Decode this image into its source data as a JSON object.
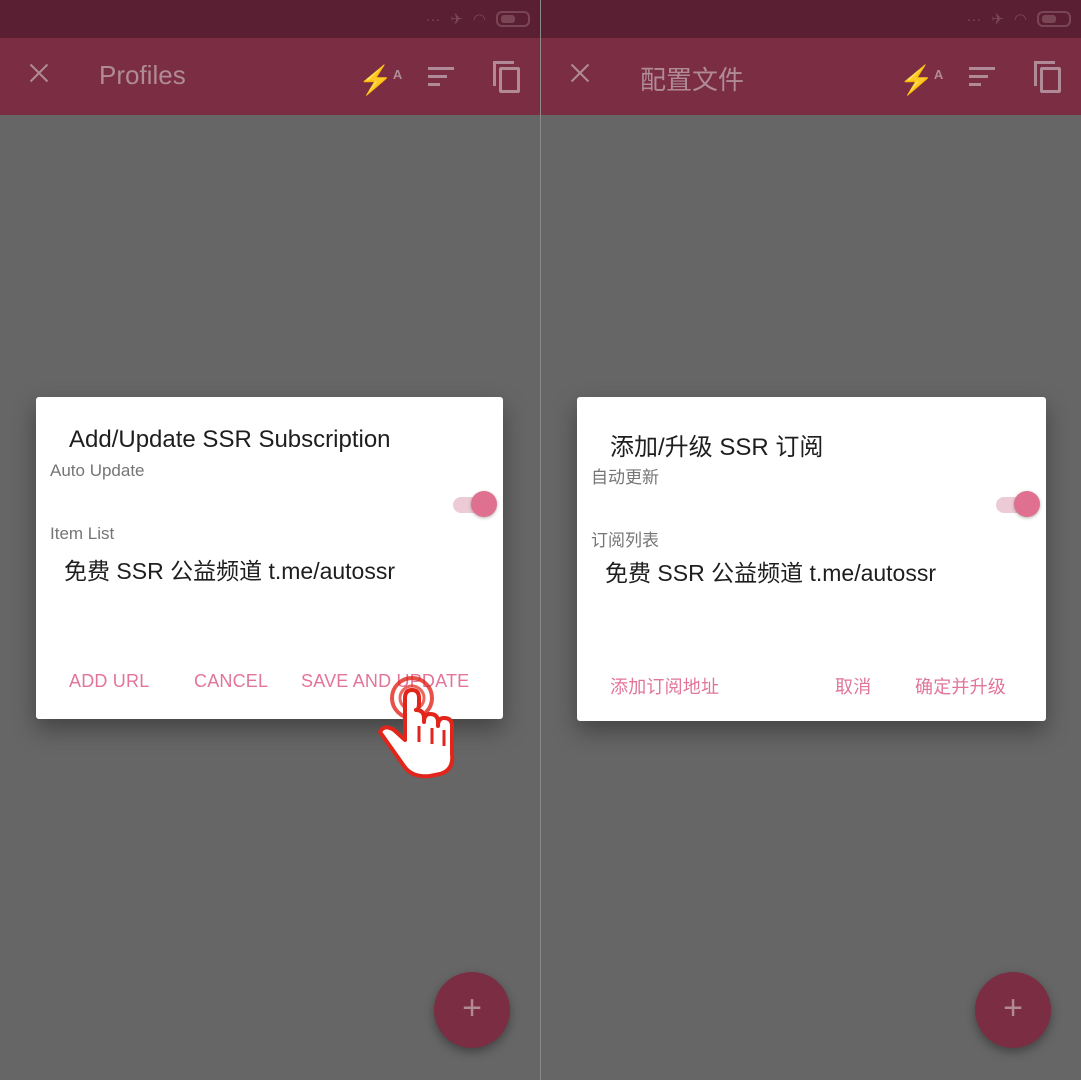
{
  "colors": {
    "accent": "#e27598",
    "appbar": "#7b2d43",
    "statusbar": "#5b1f33",
    "scrim": "#666666"
  },
  "left": {
    "appbar": {
      "title": "Profiles"
    },
    "dialog": {
      "title": "Add/Update SSR Subscription",
      "auto_update_label": "Auto Update",
      "auto_update_on": true,
      "item_list_label": "Item List",
      "item": "免费 SSR 公益频道 t.me/autossr",
      "buttons": {
        "add_url": "ADD URL",
        "cancel": "CANCEL",
        "save_update": "SAVE AND UPDATE"
      }
    },
    "fab": {
      "label": "+"
    }
  },
  "right": {
    "appbar": {
      "title": "配置文件"
    },
    "dialog": {
      "title": "添加/升级 SSR 订阅",
      "auto_update_label": "自动更新",
      "auto_update_on": true,
      "item_list_label": "订阅列表",
      "item": "免费 SSR 公益频道 t.me/autossr",
      "buttons": {
        "add_url": "添加订阅地址",
        "cancel": "取消",
        "save_update": "确定并升级"
      }
    },
    "fab": {
      "label": "+"
    }
  },
  "icons": [
    "close-icon",
    "flash-auto-icon",
    "sort-icon",
    "copy-icon",
    "wifi-icon",
    "airplane-icon",
    "battery-icon",
    "tap-hand-icon"
  ]
}
